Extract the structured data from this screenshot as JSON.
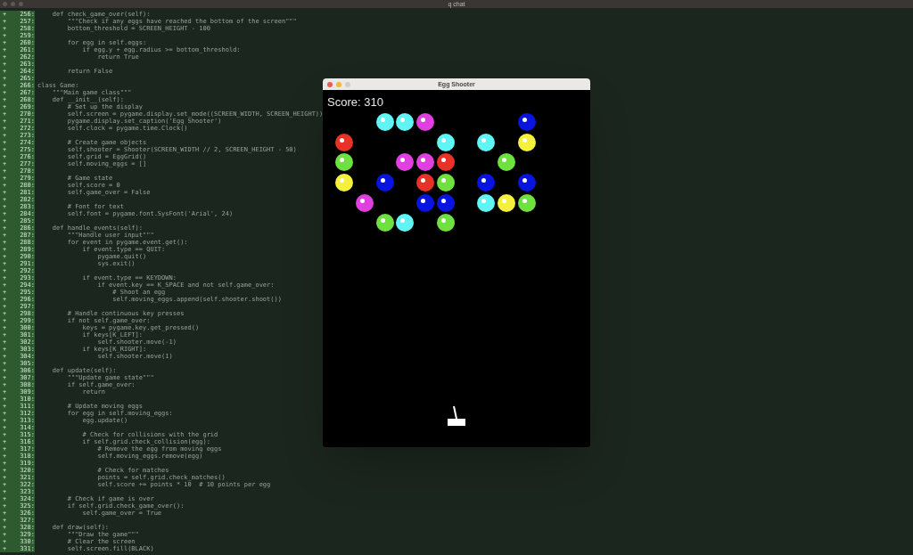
{
  "window": {
    "title": "q chat"
  },
  "code_lines": [
    {
      "mark": "+",
      "number": "256:",
      "text": "    def check_game_over(self):"
    },
    {
      "mark": "+",
      "number": "257:",
      "text": "        \"\"\"Check if any eggs have reached the bottom of the screen\"\"\""
    },
    {
      "mark": "+",
      "number": "258:",
      "text": "        bottom_threshold = SCREEN_HEIGHT - 100"
    },
    {
      "mark": "+",
      "number": "259:"
    },
    {
      "mark": "+",
      "number": "260:",
      "text": "        for egg in self.eggs:"
    },
    {
      "mark": "+",
      "number": "261:",
      "text": "            if egg.y + egg.radius >= bottom_threshold:"
    },
    {
      "mark": "+",
      "number": "262:",
      "text": "                return True"
    },
    {
      "mark": "+",
      "number": "263:"
    },
    {
      "mark": "+",
      "number": "264:",
      "text": "        return False"
    },
    {
      "mark": "+",
      "number": "265:"
    },
    {
      "mark": "+",
      "number": "266:",
      "text": "class Game:"
    },
    {
      "mark": "+",
      "number": "267:",
      "text": "    \"\"\"Main game class\"\"\""
    },
    {
      "mark": "+",
      "number": "268:",
      "text": "    def __init__(self):"
    },
    {
      "mark": "+",
      "number": "269:",
      "text": "        # Set up the display"
    },
    {
      "mark": "+",
      "number": "270:",
      "text": "        self.screen = pygame.display.set_mode((SCREEN_WIDTH, SCREEN_HEIGHT))"
    },
    {
      "mark": "+",
      "number": "271:",
      "text": "        pygame.display.set_caption('Egg Shooter')"
    },
    {
      "mark": "+",
      "number": "272:",
      "text": "        self.clock = pygame.time.Clock()"
    },
    {
      "mark": "+",
      "number": "273:"
    },
    {
      "mark": "+",
      "number": "274:",
      "text": "        # Create game objects"
    },
    {
      "mark": "+",
      "number": "275:",
      "text": "        self.shooter = Shooter(SCREEN_WIDTH // 2, SCREEN_HEIGHT - 50)"
    },
    {
      "mark": "+",
      "number": "276:",
      "text": "        self.grid = EggGrid()"
    },
    {
      "mark": "+",
      "number": "277:",
      "text": "        self.moving_eggs = []"
    },
    {
      "mark": "+",
      "number": "278:"
    },
    {
      "mark": "+",
      "number": "279:",
      "text": "        # Game state"
    },
    {
      "mark": "+",
      "number": "280:",
      "text": "        self.score = 0"
    },
    {
      "mark": "+",
      "number": "281:",
      "text": "        self.game_over = False"
    },
    {
      "mark": "+",
      "number": "282:"
    },
    {
      "mark": "+",
      "number": "283:",
      "text": "        # Font for text"
    },
    {
      "mark": "+",
      "number": "284:",
      "text": "        self.font = pygame.font.SysFont('Arial', 24)"
    },
    {
      "mark": "+",
      "number": "285:"
    },
    {
      "mark": "+",
      "number": "286:",
      "text": "    def handle_events(self):"
    },
    {
      "mark": "+",
      "number": "287:",
      "text": "        \"\"\"Handle user input\"\"\""
    },
    {
      "mark": "+",
      "number": "288:",
      "text": "        for event in pygame.event.get():"
    },
    {
      "mark": "+",
      "number": "289:",
      "text": "            if event.type == QUIT:"
    },
    {
      "mark": "+",
      "number": "290:",
      "text": "                pygame.quit()"
    },
    {
      "mark": "+",
      "number": "291:",
      "text": "                sys.exit()"
    },
    {
      "mark": "+",
      "number": "292:"
    },
    {
      "mark": "+",
      "number": "293:",
      "text": "            if event.type == KEYDOWN:"
    },
    {
      "mark": "+",
      "number": "294:",
      "text": "                if event.key == K_SPACE and not self.game_over:"
    },
    {
      "mark": "+",
      "number": "295:",
      "text": "                    # Shoot an egg"
    },
    {
      "mark": "+",
      "number": "296:",
      "text": "                    self.moving_eggs.append(self.shooter.shoot())"
    },
    {
      "mark": "+",
      "number": "297:"
    },
    {
      "mark": "+",
      "number": "298:",
      "text": "        # Handle continuous key presses"
    },
    {
      "mark": "+",
      "number": "299:",
      "text": "        if not self.game_over:"
    },
    {
      "mark": "+",
      "number": "300:",
      "text": "            keys = pygame.key.get_pressed()"
    },
    {
      "mark": "+",
      "number": "301:",
      "text": "            if keys[K_LEFT]:"
    },
    {
      "mark": "+",
      "number": "302:",
      "text": "                self.shooter.move(-1)"
    },
    {
      "mark": "+",
      "number": "303:",
      "text": "            if keys[K_RIGHT]:"
    },
    {
      "mark": "+",
      "number": "304:",
      "text": "                self.shooter.move(1)"
    },
    {
      "mark": "+",
      "number": "305:"
    },
    {
      "mark": "+",
      "number": "306:",
      "text": "    def update(self):"
    },
    {
      "mark": "+",
      "number": "307:",
      "text": "        \"\"\"Update game state\"\"\""
    },
    {
      "mark": "+",
      "number": "308:",
      "text": "        if self.game_over:"
    },
    {
      "mark": "+",
      "number": "309:",
      "text": "            return"
    },
    {
      "mark": "+",
      "number": "310:"
    },
    {
      "mark": "+",
      "number": "311:",
      "text": "        # Update moving eggs"
    },
    {
      "mark": "+",
      "number": "312:",
      "text": "        for egg in self.moving_eggs:"
    },
    {
      "mark": "+",
      "number": "313:",
      "text": "            egg.update()"
    },
    {
      "mark": "+",
      "number": "314:"
    },
    {
      "mark": "+",
      "number": "315:",
      "text": "            # Check for collisions with the grid"
    },
    {
      "mark": "+",
      "number": "316:",
      "text": "            if self.grid.check_collision(egg):"
    },
    {
      "mark": "+",
      "number": "317:",
      "text": "                # Remove the egg from moving eggs"
    },
    {
      "mark": "+",
      "number": "318:",
      "text": "                self.moving_eggs.remove(egg)"
    },
    {
      "mark": "+",
      "number": "319:"
    },
    {
      "mark": "+",
      "number": "320:",
      "text": "                # Check for matches"
    },
    {
      "mark": "+",
      "number": "321:",
      "text": "                points = self.grid.check_matches()"
    },
    {
      "mark": "+",
      "number": "322:",
      "text": "                self.score += points * 10  # 10 points per egg"
    },
    {
      "mark": "+",
      "number": "323:"
    },
    {
      "mark": "+",
      "number": "324:",
      "text": "        # Check if game is over"
    },
    {
      "mark": "+",
      "number": "325:",
      "text": "        if self.grid.check_game_over():"
    },
    {
      "mark": "+",
      "number": "326:",
      "text": "            self.game_over = True"
    },
    {
      "mark": "+",
      "number": "327:"
    },
    {
      "mark": "+",
      "number": "328:",
      "text": "    def draw(self):"
    },
    {
      "mark": "+",
      "number": "329:",
      "text": "        \"\"\"Draw the game\"\"\""
    },
    {
      "mark": "+",
      "number": "330:",
      "text": "        # Clear the screen"
    },
    {
      "mark": "+",
      "number": "331:",
      "text": "        self.screen.fill(BLACK)"
    }
  ],
  "game_window": {
    "title": "Egg Shooter",
    "score": "Score: 310",
    "egg_grid": {
      "rows": [
        {
          "cells": [
            {
              "kind": "gap"
            },
            {
              "kind": "gap"
            },
            {
              "kind": "egg",
              "color": "#5ff5f5"
            },
            {
              "kind": "egg",
              "color": "#5ff5f5"
            },
            {
              "kind": "egg",
              "color": "#e040e0"
            },
            {
              "kind": "gap"
            },
            {
              "kind": "gap"
            },
            {
              "kind": "gap"
            },
            {
              "kind": "gap"
            },
            {
              "kind": "egg",
              "color": "#0a14e0"
            }
          ]
        },
        {
          "cells": [
            {
              "kind": "egg",
              "color": "#e83228"
            },
            {
              "kind": "gap"
            },
            {
              "kind": "gap"
            },
            {
              "kind": "gap"
            },
            {
              "kind": "gap"
            },
            {
              "kind": "egg",
              "color": "#5ff5f5"
            },
            {
              "kind": "gap"
            },
            {
              "kind": "egg",
              "color": "#5ff5f5"
            },
            {
              "kind": "gap"
            },
            {
              "kind": "egg",
              "color": "#f5f03c"
            }
          ]
        },
        {
          "cells": [
            {
              "kind": "egg",
              "color": "#6ee040"
            },
            {
              "kind": "gap"
            },
            {
              "kind": "gap"
            },
            {
              "kind": "egg",
              "color": "#e040e0"
            },
            {
              "kind": "egg",
              "color": "#e040e0"
            },
            {
              "kind": "egg",
              "color": "#e83228"
            },
            {
              "kind": "gap"
            },
            {
              "kind": "gap"
            },
            {
              "kind": "egg",
              "color": "#6ee040"
            },
            {
              "kind": "gap"
            }
          ]
        },
        {
          "cells": [
            {
              "kind": "egg",
              "color": "#f5f03c"
            },
            {
              "kind": "gap"
            },
            {
              "kind": "egg",
              "color": "#0a14e0"
            },
            {
              "kind": "gap"
            },
            {
              "kind": "egg",
              "color": "#e83228"
            },
            {
              "kind": "egg",
              "color": "#6ee040"
            },
            {
              "kind": "gap"
            },
            {
              "kind": "egg",
              "color": "#0a14e0"
            },
            {
              "kind": "gap"
            },
            {
              "kind": "egg",
              "color": "#0a14e0"
            }
          ]
        },
        {
          "cells": [
            {
              "kind": "gap"
            },
            {
              "kind": "egg",
              "color": "#e040e0"
            },
            {
              "kind": "gap"
            },
            {
              "kind": "gap"
            },
            {
              "kind": "egg",
              "color": "#0a14e0"
            },
            {
              "kind": "egg",
              "color": "#0a14e0"
            },
            {
              "kind": "gap"
            },
            {
              "kind": "egg",
              "color": "#5ff5f5"
            },
            {
              "kind": "egg",
              "color": "#f5f03c"
            },
            {
              "kind": "egg",
              "color": "#6ee040"
            }
          ]
        },
        {
          "cells": [
            {
              "kind": "gap"
            },
            {
              "kind": "gap"
            },
            {
              "kind": "egg",
              "color": "#6ee040"
            },
            {
              "kind": "egg",
              "color": "#5ff5f5"
            },
            {
              "kind": "gap"
            },
            {
              "kind": "egg",
              "color": "#6ee040"
            },
            {
              "kind": "gap"
            },
            {
              "kind": "gap"
            },
            {
              "kind": "gap"
            },
            {
              "kind": "gap"
            }
          ]
        }
      ]
    }
  }
}
